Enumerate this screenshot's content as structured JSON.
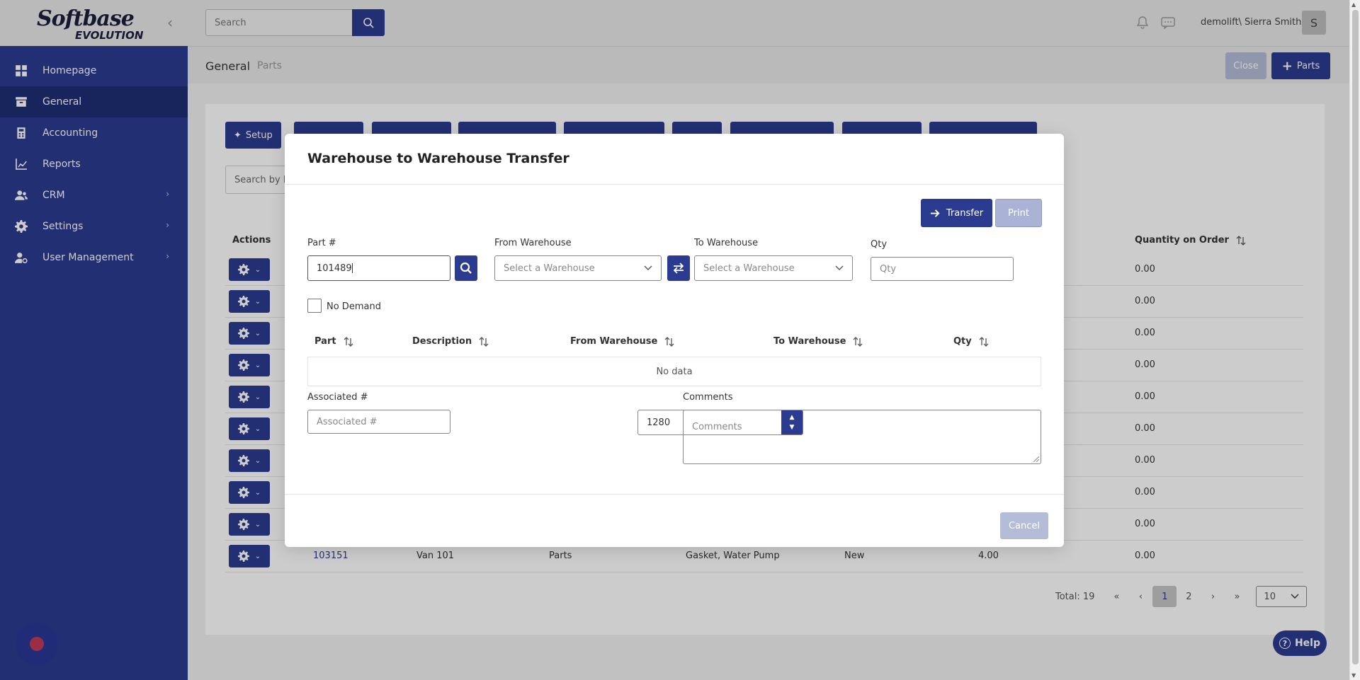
{
  "brand": {
    "line1": "Softbase",
    "line2": "EVOLUTION"
  },
  "colors": {
    "primary": "#2b3b8f",
    "sidebar": "#2b3b8f",
    "disabled": "#b4bcd8"
  },
  "sidebar": {
    "items": [
      {
        "label": "Homepage",
        "icon": "grid-icon"
      },
      {
        "label": "General",
        "icon": "archive-icon",
        "active": true
      },
      {
        "label": "Accounting",
        "icon": "calculator-icon"
      },
      {
        "label": "Reports",
        "icon": "chart-icon"
      },
      {
        "label": "CRM",
        "icon": "users-icon",
        "expandable": true
      },
      {
        "label": "Settings",
        "icon": "gear-icon",
        "expandable": true
      },
      {
        "label": "User Management",
        "icon": "user-gear-icon",
        "expandable": true
      }
    ]
  },
  "topbar": {
    "search_placeholder": "Search",
    "user": "demolift\\ Sierra Smith",
    "avatar_initial": "S"
  },
  "breadcrumb": {
    "section": "General",
    "page": "Parts"
  },
  "header_actions": {
    "close": "Close",
    "add_parts": "Parts"
  },
  "main": {
    "setup_label": "Setup",
    "search_placeholder": "Search by Pa",
    "actions_header": "Actions",
    "qty_on_order_header": "Quantity on Order",
    "rows": [
      {
        "qoo": "0.00"
      },
      {
        "qoo": "0.00"
      },
      {
        "qoo": "0.00"
      },
      {
        "qoo": "0.00"
      },
      {
        "qoo": "0.00"
      },
      {
        "qoo": "0.00"
      },
      {
        "qoo": "0.00"
      },
      {
        "qoo": "0.00"
      },
      {
        "qoo": "0.00"
      },
      {
        "part": "103151",
        "warehouse": "Van 101",
        "type": "Parts",
        "description": "Gasket, Water Pump",
        "condition": "New",
        "qty": "4.00",
        "qoo": "0.00"
      }
    ],
    "pagination": {
      "total": "Total: 19",
      "pages": [
        "1",
        "2"
      ],
      "current": "1",
      "page_size": "10"
    }
  },
  "help_label": "Help",
  "modal": {
    "title": "Warehouse to Warehouse Transfer",
    "transfer_label": "Transfer",
    "print_label": "Print",
    "part_label": "Part #",
    "part_value": "101489",
    "from_label": "From Warehouse",
    "from_placeholder": "Select a Warehouse",
    "to_label": "To Warehouse",
    "to_placeholder": "Select a Warehouse",
    "qty_label": "Qty",
    "qty_placeholder": "Qty",
    "no_demand_label": "No Demand",
    "table_headers": [
      "Part",
      "Description",
      "From Warehouse",
      "To Warehouse",
      "Qty"
    ],
    "no_data": "No data",
    "associated_label": "Associated #",
    "associated_placeholder": "Associated #",
    "number_value": "1280",
    "comments_label": "Comments",
    "comments_placeholder": "Comments",
    "cancel_label": "Cancel"
  }
}
